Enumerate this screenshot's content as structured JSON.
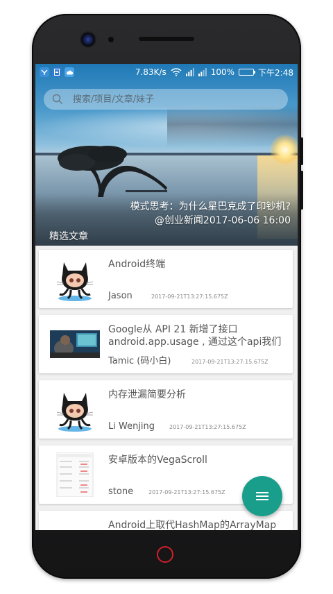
{
  "status_bar": {
    "speed": "7.83K/s",
    "battery": "100%",
    "time": "下午2:48"
  },
  "search": {
    "placeholder": "搜索/项目/文章/妹子"
  },
  "banner": {
    "headline": "模式思考：为什么星巴克成了印钞机?",
    "source_date": "@创业新闻2017-06-06 16:00",
    "section_label": "精选文章"
  },
  "articles": [
    {
      "title": "Android终端",
      "author": "Jason",
      "time": "2017-09-21T13:27:15.675Z",
      "thumb": "octocat-icon"
    },
    {
      "title": "Google从 API 21 新增了接口 android.app.usage , 通过这个api我们",
      "author": "Tamic (码小白)",
      "time": "2017-09-21T13:27:15.675Z",
      "thumb": "photo-thumbnail"
    },
    {
      "title": "内存泄漏简要分析",
      "author": "Li Wenjing",
      "time": "2017-09-21T13:27:15.675Z",
      "thumb": "octocat-icon"
    },
    {
      "title": "安卓版本的VegaScroll",
      "author": "stone",
      "time": "2017-09-21T13:27:15.675Z",
      "thumb": "screenshot-thumbnail"
    },
    {
      "title": "Android上取代HashMap的ArrayMap",
      "author": "",
      "time": "",
      "thumb": "document-thumbnail"
    }
  ],
  "fab": {
    "icon": "menu-icon"
  },
  "colors": {
    "fab": "#1a9e8c",
    "home_button": "#d0202a"
  }
}
